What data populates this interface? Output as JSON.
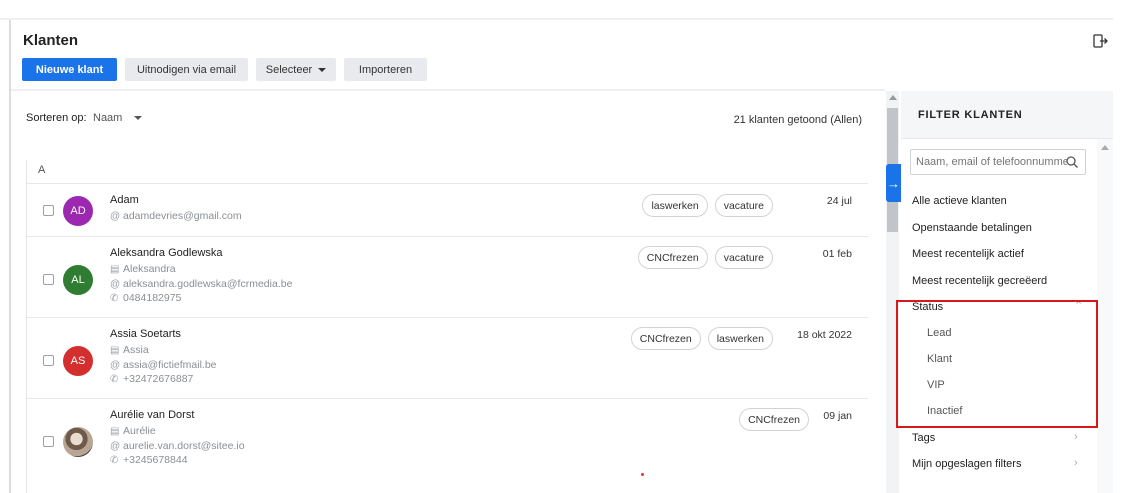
{
  "header": {
    "title": "Klanten",
    "buttons": {
      "new_client": "Nieuwe klant",
      "invite": "Uitnodigen via email",
      "select": "Selecteer",
      "import": "Importeren"
    }
  },
  "list": {
    "sort_label": "Sorteren op:",
    "sort_value": "Naam",
    "count_text": "21 klanten getoond (Allen)",
    "group_letter": "A",
    "rows": [
      {
        "initials": "AD",
        "avatar_color": "#9c27b0",
        "name": "Adam",
        "email": "adamdevries@gmail.com",
        "tags": [
          "laswerken",
          "vacature"
        ],
        "date": "24 jul"
      },
      {
        "initials": "AL",
        "avatar_color": "#2e7d32",
        "name": "Aleksandra Godlewska",
        "firstname": "Aleksandra",
        "email": "aleksandra.godlewska@fcrmedia.be",
        "phone": "0484182975",
        "tags": [
          "CNCfrezen",
          "vacature"
        ],
        "date": "01 feb"
      },
      {
        "initials": "AS",
        "avatar_color": "#d32f2f",
        "name": "Assia Soetarts",
        "firstname": "Assia",
        "email": "assia@fictiefmail.be",
        "phone": "+32472676887",
        "tags": [
          "CNCfrezen",
          "laswerken"
        ],
        "date": "18 okt 2022"
      },
      {
        "initials": "",
        "avatar_color": "#8d7b6b",
        "name": "Aurélie van Dorst",
        "firstname": "Aurélie",
        "email": "aurelie.van.dorst@sitee.io",
        "phone": "+3245678844",
        "tags": [
          "CNCfrezen"
        ],
        "date": "09 jan"
      }
    ]
  },
  "filter": {
    "title": "FILTER KLANTEN",
    "search_placeholder": "Naam, email of telefoonnummer",
    "items": [
      "Alle actieve klanten",
      "Openstaande betalingen",
      "Meest recentelijk actief",
      "Meest recentelijk gecreëerd"
    ],
    "status_label": "Status",
    "status_options": [
      "Lead",
      "Klant",
      "VIP",
      "Inactief"
    ],
    "tags_label": "Tags",
    "saved_label": "Mijn opgeslagen filters"
  },
  "colors": {
    "primary": "#1a73e8",
    "highlight": "#d7191c"
  }
}
